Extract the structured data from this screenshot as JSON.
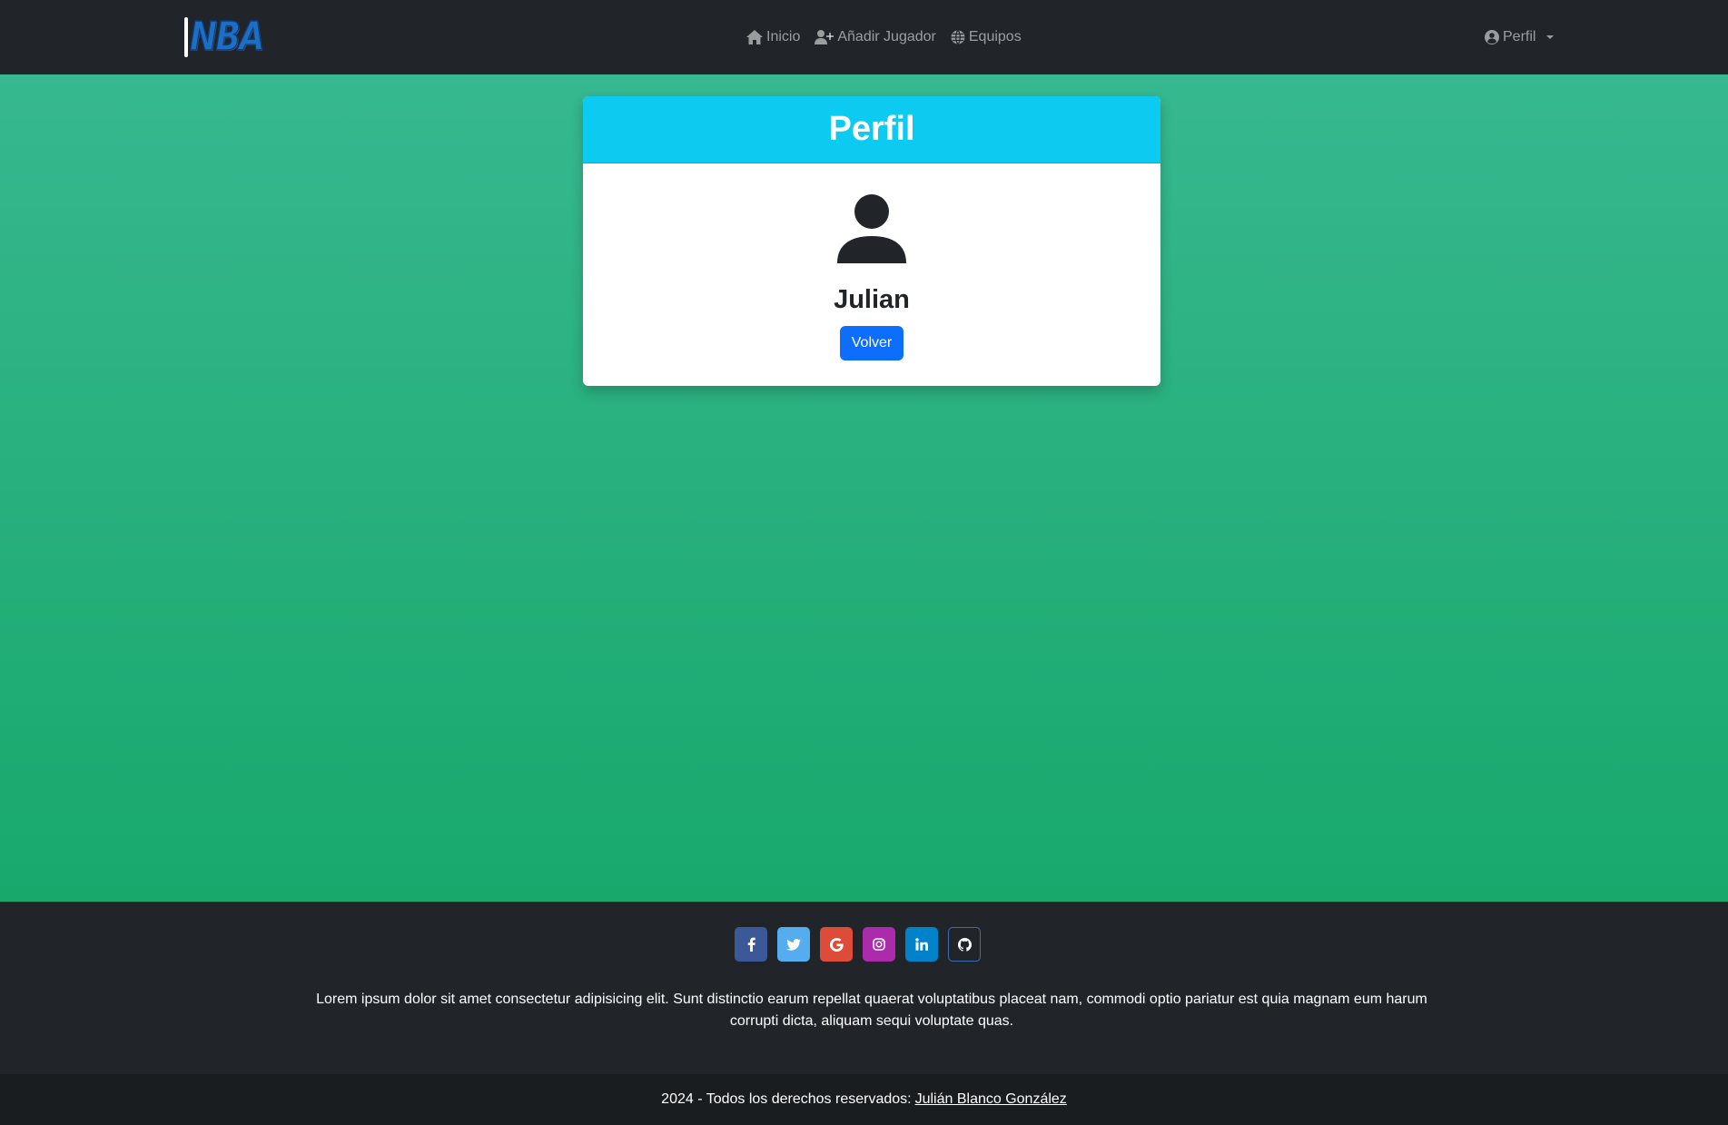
{
  "navbar": {
    "logo_text": "NBA",
    "links": [
      {
        "label": "Inicio",
        "icon": "house-icon"
      },
      {
        "label": "Añadir Jugador",
        "icon": "user-plus-icon"
      },
      {
        "label": "Equipos",
        "icon": "globe-icon"
      }
    ],
    "profile": {
      "label": "Perfil",
      "icon": "user-circle-icon"
    }
  },
  "card": {
    "title": "Perfil",
    "user_icon": "user-icon",
    "name": "Julian",
    "button_label": "Volver"
  },
  "footer": {
    "socials": [
      {
        "name": "facebook",
        "icon": "facebook-icon",
        "color": "#3b5998"
      },
      {
        "name": "twitter",
        "icon": "twitter-icon",
        "color": "#55acee"
      },
      {
        "name": "google",
        "icon": "google-icon",
        "color": "#dd4b39"
      },
      {
        "name": "instagram",
        "icon": "instagram-icon",
        "color": "#ac2bac"
      },
      {
        "name": "linkedin",
        "icon": "linkedin-icon",
        "color": "#0082ca"
      },
      {
        "name": "github",
        "icon": "github-icon",
        "color": "#333333"
      }
    ],
    "text": "Lorem ipsum dolor sit amet consectetur adipisicing elit. Sunt distinctio earum repellat quaerat voluptatibus placeat nam, commodi optio pariatur est quia magnam eum harum corrupti dicta, aliquam sequi voluptate quas.",
    "copyright_prefix": "2024 - Todos los derechos reservados:",
    "copyright_link": "Julián Blanco González"
  },
  "colors": {
    "navbar_bg": "#212529",
    "gradient_top": "#37b88f",
    "gradient_bottom": "#18a86c",
    "card_header": "#0dcaf0",
    "primary_button": "#0d6efd"
  }
}
